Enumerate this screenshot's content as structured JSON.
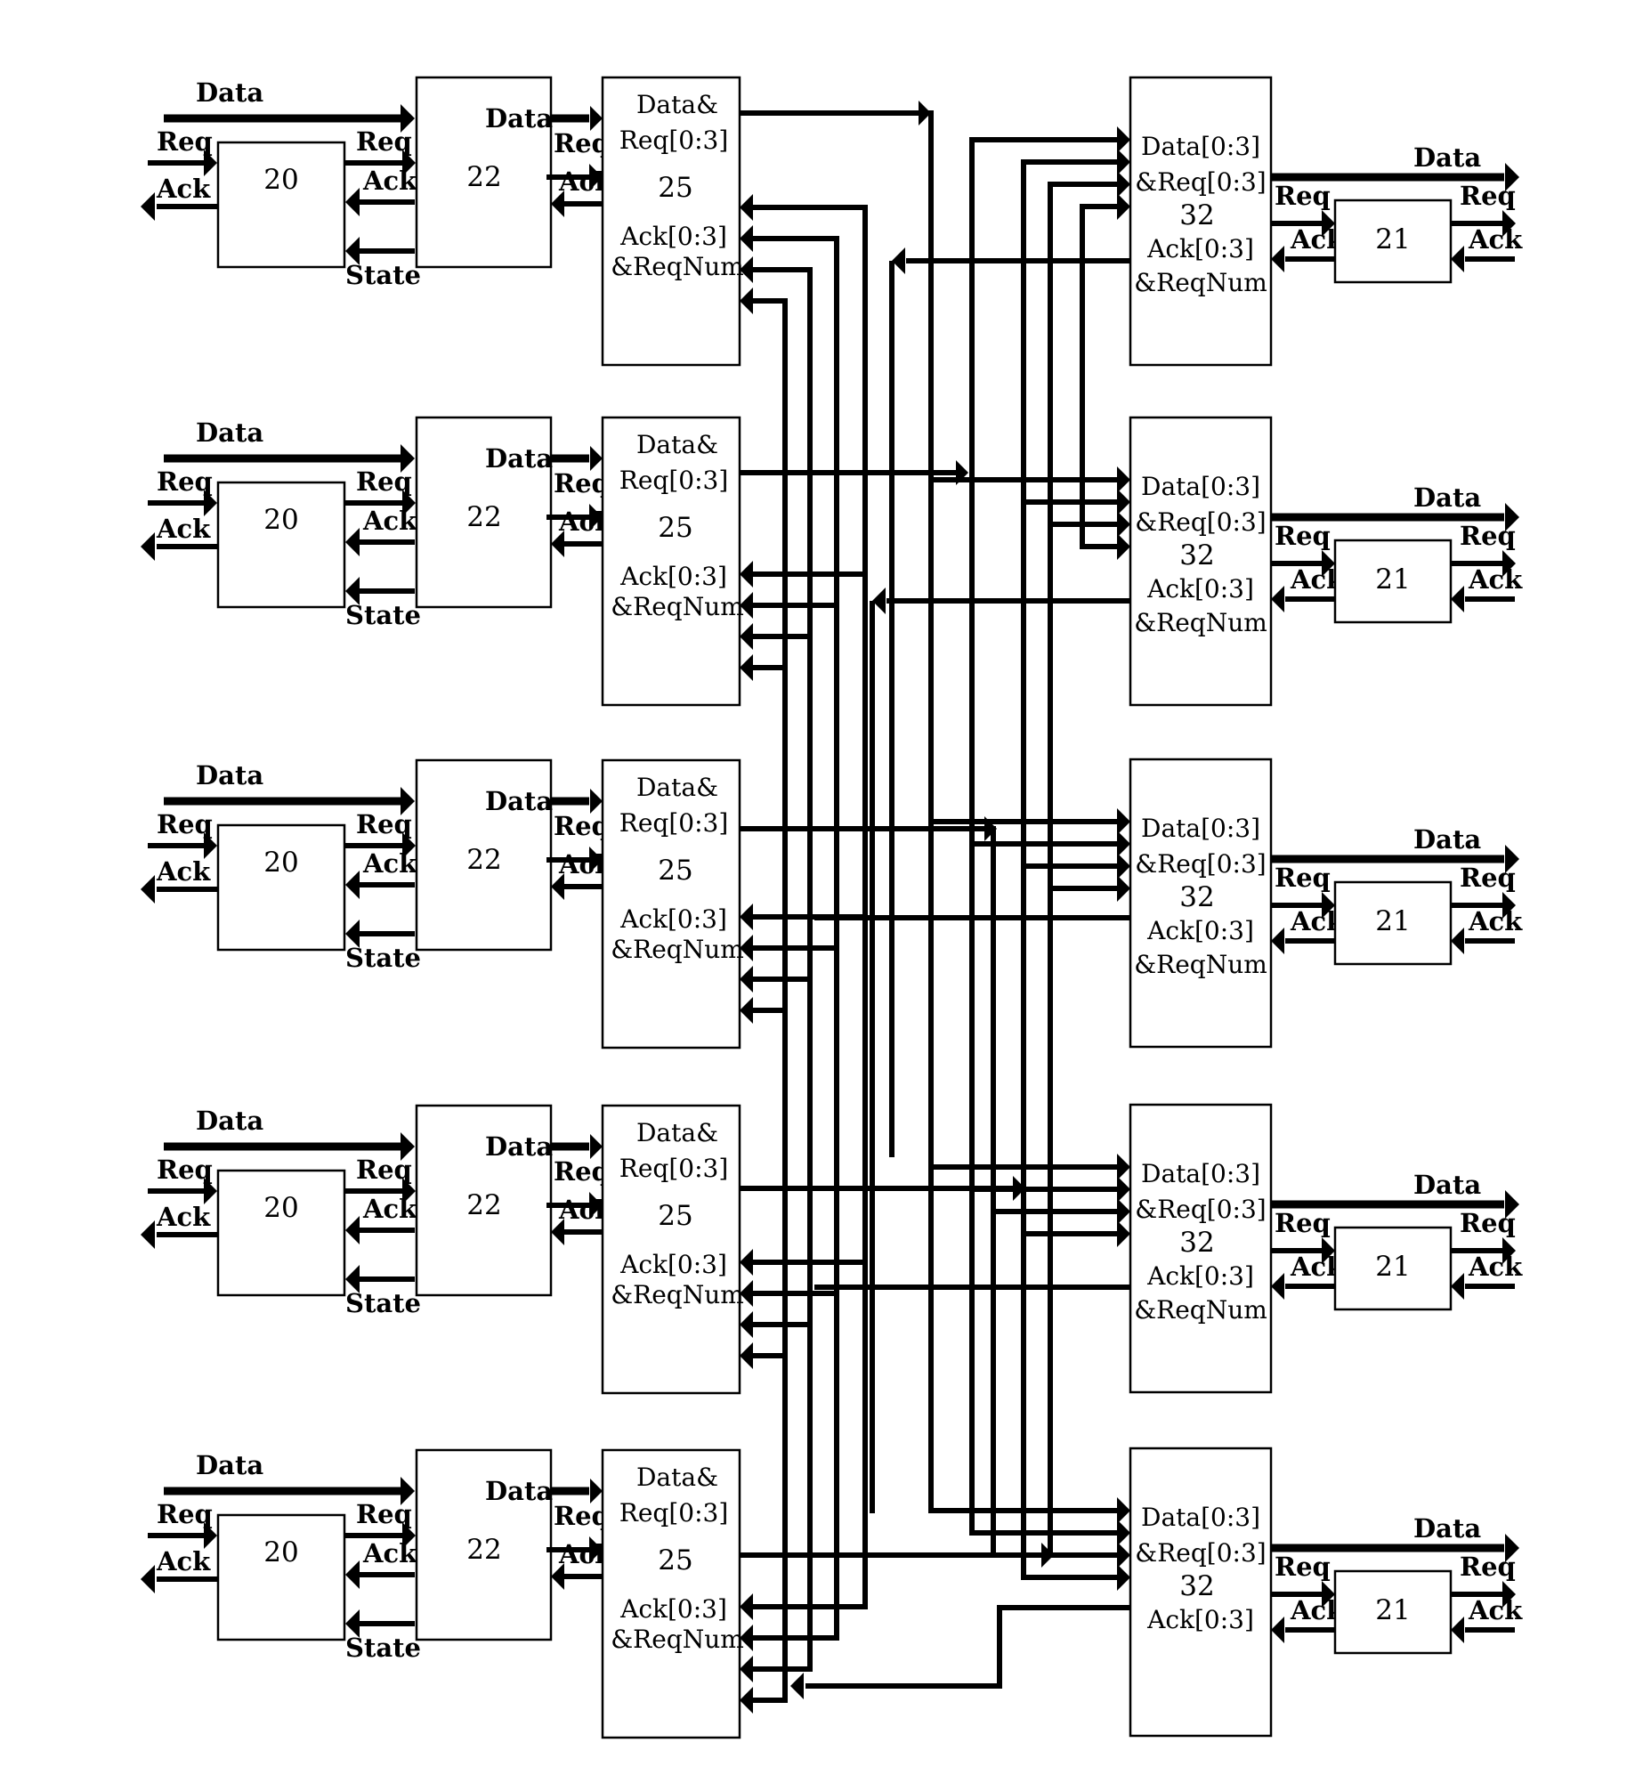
{
  "colors": {
    "line": "#000000",
    "background": "#ffffff"
  },
  "labels": {
    "data": "Data",
    "req": "Req",
    "ack": "Ack",
    "state": "State"
  },
  "source_units": [
    {
      "id_20": "20",
      "id_22": "22",
      "id_25": "25",
      "box25_lines": [
        "Data&",
        "Req[0:3]",
        "Ack[0:3]",
        "&ReqNum"
      ]
    },
    {
      "id_20": "20",
      "id_22": "22",
      "id_25": "25",
      "box25_lines": [
        "Data&",
        "Req[0:3]",
        "Ack[0:3]",
        "&ReqNum"
      ]
    },
    {
      "id_20": "20",
      "id_22": "22",
      "id_25": "25",
      "box25_lines": [
        "Data&",
        "Req[0:3]",
        "Ack[0:3]",
        "&ReqNum"
      ]
    },
    {
      "id_20": "20",
      "id_22": "22",
      "id_25": "25",
      "box25_lines": [
        "Data&",
        "Req[0:3]",
        "Ack[0:3]",
        "&ReqNum"
      ]
    },
    {
      "id_20": "20",
      "id_22": "22",
      "id_25": "25",
      "box25_lines": [
        "Data&",
        "Req[0:3]",
        "Ack[0:3]",
        "&ReqNum"
      ]
    }
  ],
  "dest_units": [
    {
      "id_32": "32",
      "id_21": "21",
      "box32_lines": [
        "Data[0:3]",
        "&Req[0:3]",
        "Ack[0:3]",
        "&ReqNum"
      ]
    },
    {
      "id_32": "32",
      "id_21": "21",
      "box32_lines": [
        "Data[0:3]",
        "&Req[0:3]",
        "Ack[0:3]",
        "&ReqNum"
      ]
    },
    {
      "id_32": "32",
      "id_21": "21",
      "box32_lines": [
        "Data[0:3]",
        "&Req[0:3]",
        "Ack[0:3]",
        "&ReqNum"
      ]
    },
    {
      "id_32": "32",
      "id_21": "21",
      "box32_lines": [
        "Data[0:3]",
        "&Req[0:3]",
        "Ack[0:3]",
        "&ReqNum"
      ]
    },
    {
      "id_32": "32",
      "id_21": "21",
      "box32_lines": [
        "Data[0:3]",
        "&Req[0:3]",
        "Ack[0:3]"
      ]
    }
  ]
}
